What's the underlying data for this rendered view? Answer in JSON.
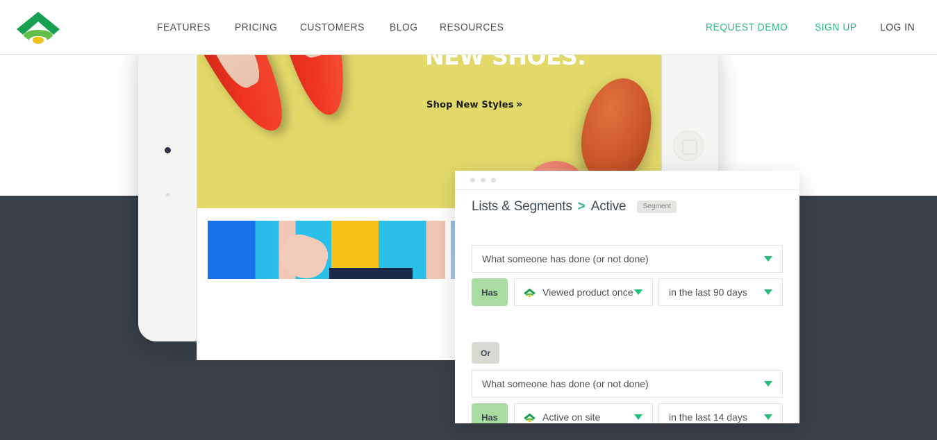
{
  "brand": {
    "logo_icon": "klaviyo-wifi-logo",
    "color_green_dark": "#17a04e",
    "color_green_mid": "#6cbf4b",
    "color_yellow": "#f0c419",
    "accent": "#2fb87b"
  },
  "header": {
    "nav": [
      {
        "label": "FEATURES",
        "name": "nav-features"
      },
      {
        "label": "PRICING",
        "name": "nav-pricing"
      },
      {
        "label": "CUSTOMERS",
        "name": "nav-customers"
      },
      {
        "label": "BLOG",
        "name": "nav-blog"
      },
      {
        "label": "RESOURCES",
        "name": "nav-resources"
      }
    ],
    "actions": [
      {
        "label": "REQUEST DEMO",
        "style": "green"
      },
      {
        "label": "SIGN UP",
        "style": "green"
      },
      {
        "label": "LOG IN",
        "style": "dark"
      }
    ]
  },
  "tablet": {
    "banner": {
      "headline": "IT'S A SHOO-IN.\nNEW SHOES.",
      "cta": "Shop New Styles",
      "cta_chevron": "»",
      "background_color": "#e2d96a",
      "headline_color": "#ffffff"
    }
  },
  "panel": {
    "titlebar_dots": 3,
    "breadcrumb": {
      "root": "Lists & Segments",
      "separator": ">",
      "current": "Active",
      "badge": "Segment"
    },
    "groups": [
      {
        "trigger_label": "What someone has done (or not done)",
        "operator": "Has",
        "condition_label": "Viewed product once",
        "condition_icon": "klaviyo-wifi-icon",
        "timeframe_label": "in the last 90 days"
      },
      {
        "joiner": "Or",
        "trigger_label": "What someone has done (or not done)",
        "operator": "Has",
        "condition_label": "Active on site",
        "condition_icon": "klaviyo-wifi-icon",
        "timeframe_label": "in the last 14 days"
      }
    ]
  }
}
